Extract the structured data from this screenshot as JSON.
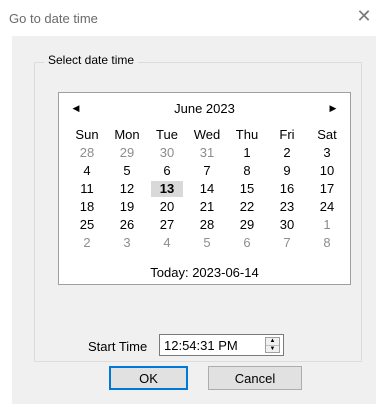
{
  "window": {
    "title": "Go to date time",
    "close_glyph": "✕"
  },
  "group": {
    "legend": "Select date time"
  },
  "calendar": {
    "prev_glyph": "◀",
    "next_glyph": "▶",
    "month_title": "June 2023",
    "weekdays": [
      "Sun",
      "Mon",
      "Tue",
      "Wed",
      "Thu",
      "Fri",
      "Sat"
    ],
    "weeks": [
      [
        "28",
        "29",
        "30",
        "31",
        "1",
        "2",
        "3"
      ],
      [
        "4",
        "5",
        "6",
        "7",
        "8",
        "9",
        "10"
      ],
      [
        "11",
        "12",
        "13",
        "14",
        "15",
        "16",
        "17"
      ],
      [
        "18",
        "19",
        "20",
        "21",
        "22",
        "23",
        "24"
      ],
      [
        "25",
        "26",
        "27",
        "28",
        "29",
        "30",
        "1"
      ],
      [
        "2",
        "3",
        "4",
        "5",
        "6",
        "7",
        "8"
      ]
    ],
    "selected_day": "13",
    "today_label": "Today: 2023-06-14"
  },
  "time": {
    "label": "Start Time",
    "value": "12:54:31 PM",
    "spin_up_glyph": "▲",
    "spin_down_glyph": "▼"
  },
  "buttons": {
    "ok": "OK",
    "cancel": "Cancel"
  },
  "icons": {
    "close": "close-icon",
    "prev": "chevron-left-icon",
    "next": "chevron-right-icon",
    "spin_up": "spin-up-icon",
    "spin_down": "spin-down-icon"
  },
  "colors": {
    "client_bg": "#f0f0f0",
    "focus_border": "#0078d7",
    "selected_day_bg": "#d9d9d9",
    "other_month_text": "#8d8d8d"
  }
}
